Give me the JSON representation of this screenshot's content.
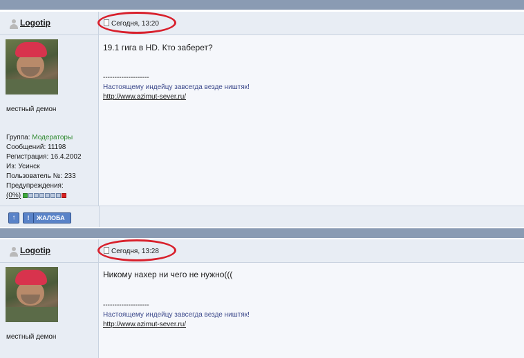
{
  "posts": [
    {
      "author": "Logotip",
      "date": "Сегодня, 13:20",
      "text": "19.1 гига в HD. Кто заберет?",
      "rank": "местный демон",
      "group_label": "Группа:",
      "group_value": "Модераторы",
      "messages": "Сообщений: 11198",
      "registration": "Регистрация: 16.4.2002",
      "from": "Из: Усинск",
      "user_no": "Пользователь №: 233",
      "warnings_label": "Предупреждения:",
      "warnings_value": "(0%)",
      "signature_dashes": "--------------------",
      "signature_quote": "Настоящему индейцу завсегда везде ништяк!",
      "signature_link": "http://www.azimut-sever.ru/"
    },
    {
      "author": "Logotip",
      "date": "Сегодня, 13:28",
      "text": "Никому нахер ни чего не нужно(((",
      "rank": "местный демон",
      "signature_dashes": "--------------------",
      "signature_quote": "Настоящему индейцу завсегда везде ништяк!",
      "signature_link": "http://www.azimut-sever.ru/"
    }
  ],
  "buttons": {
    "up_icon": "↑",
    "report_icon": "!",
    "report_label": "ЖАЛОБА"
  },
  "colors": {
    "header_bar": "#8a9bb3",
    "annotation": "#d8202c",
    "moderator_group": "#2f8a2f"
  },
  "icons": [
    "user-icon",
    "post-doc-icon",
    "arrow-up-icon",
    "exclamation-icon"
  ]
}
